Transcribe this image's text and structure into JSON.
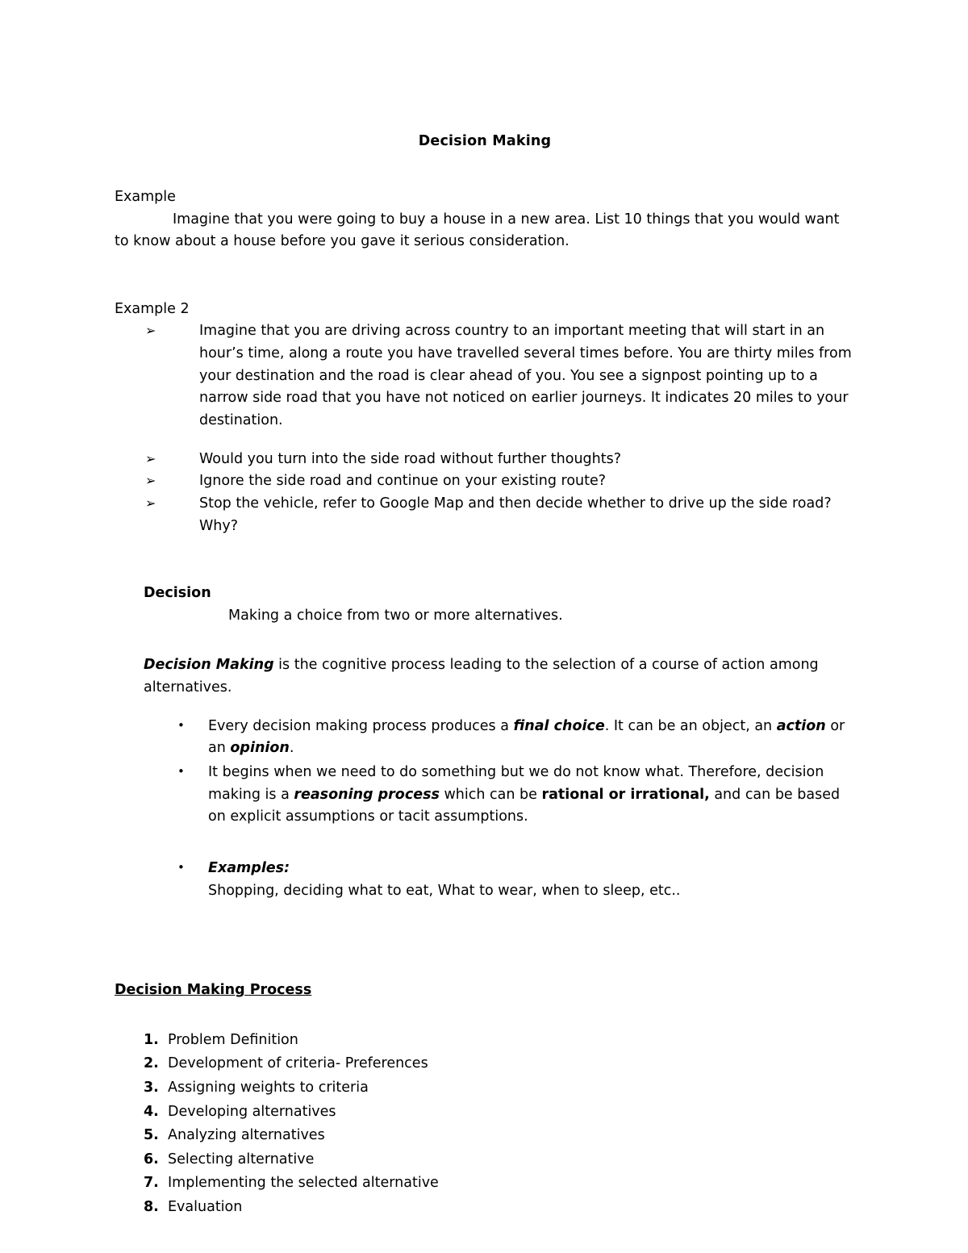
{
  "document": {
    "title": "Decision Making",
    "sections": {
      "example1": {
        "heading": "Example",
        "body": "Imagine that you were going to buy a house in a new area.  List 10 things that you would want to know about a house before you gave it serious consideration."
      },
      "example2": {
        "heading": "Example 2",
        "scenario": "Imagine that you are driving across country to an important meeting that will start in an hour’s time, along a route you have travelled several times before.  You are thirty miles from your destination and the road is clear ahead of you.  You see a signpost pointing up to a narrow side road that you have not noticed on earlier journeys.  It indicates 20 miles to your destination.",
        "questions": [
          "Would you turn into the side road without further thoughts?",
          "Ignore the side road and continue on your existing route?",
          "Stop the vehicle, refer to Google Map and then decide whether to drive up the side road? Why?"
        ],
        "bullet_glyph": "➢"
      },
      "decision": {
        "heading": "Decision",
        "definition": "Making a choice from two or more alternatives.",
        "expanded": {
          "term": "Decision Making",
          "rest": " is the cognitive process leading to the selection of a course of action among alternatives."
        },
        "points": [
          {
            "parts": [
              {
                "text": "Every decision making process produces a ",
                "style": "normal"
              },
              {
                "text": "final choice",
                "style": "bold-italic"
              },
              {
                "text": ". It can be an object, an ",
                "style": "normal"
              },
              {
                "text": "action",
                "style": "bold-italic"
              },
              {
                "text": " or an ",
                "style": "normal"
              },
              {
                "text": "opinion",
                "style": "bold-italic"
              },
              {
                "text": ".",
                "style": "normal"
              }
            ]
          },
          {
            "parts": [
              {
                "text": "It begins when we need to do something but we do not know what. Therefore, decision making is a ",
                "style": "normal"
              },
              {
                "text": "reasoning process",
                "style": "bold-italic"
              },
              {
                "text": " which can be ",
                "style": "normal"
              },
              {
                "text": "rational or irrational,",
                "style": "bold"
              },
              {
                "text": " and can be based on explicit assumptions or tacit assumptions.",
                "style": "normal"
              }
            ]
          }
        ],
        "examples": {
          "label": "Examples:",
          "text": "Shopping, deciding what to eat, What to wear, when to sleep, etc.."
        },
        "bullet_glyph": "•"
      },
      "process": {
        "heading": "Decision Making Process",
        "steps": [
          {
            "number": "1.",
            "label": "Problem Definition"
          },
          {
            "number": "2.",
            "label": "Development of criteria- Preferences"
          },
          {
            "number": "3.",
            "label": "Assigning weights to criteria"
          },
          {
            "number": "4.",
            "label": "Developing alternatives"
          },
          {
            "number": "5.",
            "label": "Analyzing alternatives"
          },
          {
            "number": "6.",
            "label": "Selecting alternative"
          },
          {
            "number": "7.",
            "label": "Implementing the selected alternative"
          },
          {
            "number": "8.",
            "label": "Evaluation"
          }
        ]
      }
    }
  }
}
